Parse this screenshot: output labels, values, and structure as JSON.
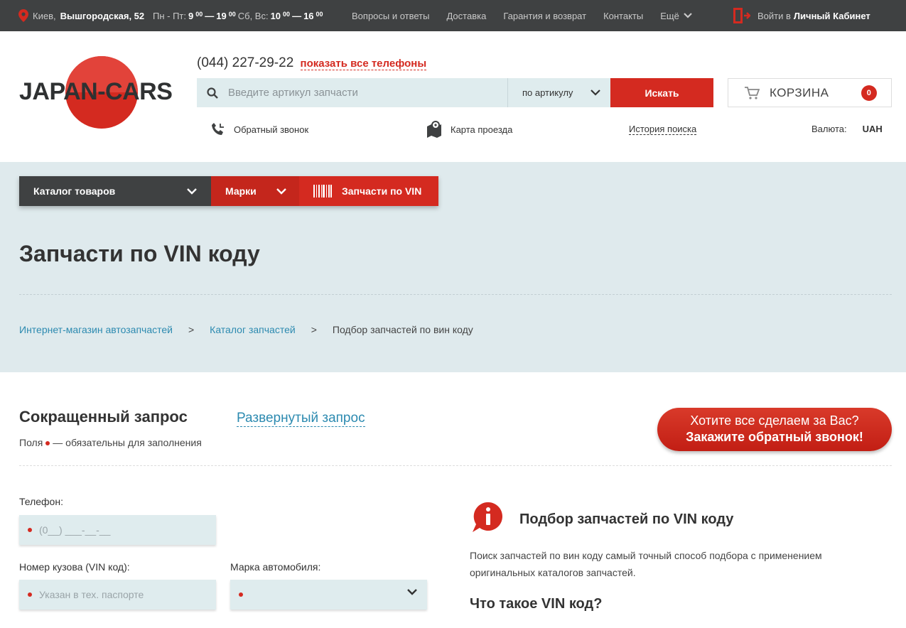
{
  "topbar": {
    "city": "Киев,",
    "street": "Вышгородская, 52",
    "hours_weekdays_label": "Пн - Пт:",
    "hours_weekdays_from": "9",
    "hours_weekdays_from_min": "00",
    "hours_weekdays_to": "19",
    "hours_weekdays_to_min": "00",
    "hours_weekend_label": "Сб, Вс:",
    "hours_weekend_from": "10",
    "hours_weekend_from_min": "00",
    "hours_weekend_to": "16",
    "hours_weekend_to_min": "00",
    "dash": "—",
    "nav": [
      "Вопросы и ответы",
      "Доставка",
      "Гарантия и возврат",
      "Контакты"
    ],
    "more": "Ещё",
    "login_prefix": "Войти в",
    "login_label": "Личный Кабинет"
  },
  "header": {
    "logo_text": "JAPAN-CARS",
    "phone": "(044) 227-29-22",
    "all_phones": "показать все телефоны",
    "search_placeholder": "Введите артикул запчасти",
    "search_mode": "по артикулу",
    "search_button": "Искать",
    "cart_label": "КОРЗИНА",
    "cart_count": "0",
    "callback": "Обратный звонок",
    "map": "Карта проезда",
    "history": "История поиска",
    "currency_label": "Валюта:",
    "currency_value": "UAH"
  },
  "menu": {
    "catalog": "Каталог товаров",
    "brands": "Марки",
    "vin": "Запчасти по VIN"
  },
  "page": {
    "title": "Запчасти по VIN коду",
    "breadcrumbs": [
      "Интернет-магазин автозапчастей",
      "Каталог запчастей",
      "Подбор запчастей по вин коду"
    ],
    "breadcrumb_sep": ">"
  },
  "form": {
    "tab_short": "Сокращенный запрос",
    "tab_extended": "Развернутый запрос",
    "required_prefix": "Поля",
    "required_suffix": "— обязательны для заполнения",
    "callback_line1": "Хотите все сделаем за Вас?",
    "callback_line2": "Закажите обратный звонок!",
    "phone_label": "Телефон:",
    "phone_placeholder": "(0__) ___-__-__",
    "vin_label": "Номер кузова (VIN код):",
    "vin_placeholder": "Указан в тех. паспорте",
    "brand_label": "Марка автомобиля:"
  },
  "info": {
    "title": "Подбор запчастей по VIN коду",
    "text": "Поиск запчастей по вин коду самый точный способ подбора с применением оригинальных каталогов запчастей.",
    "subtitle": "Что такое VIN код?"
  },
  "colors": {
    "accent": "#d42a20",
    "dark": "#3f4142",
    "light_bg": "#dfeaed",
    "link": "#2c8ab0"
  }
}
